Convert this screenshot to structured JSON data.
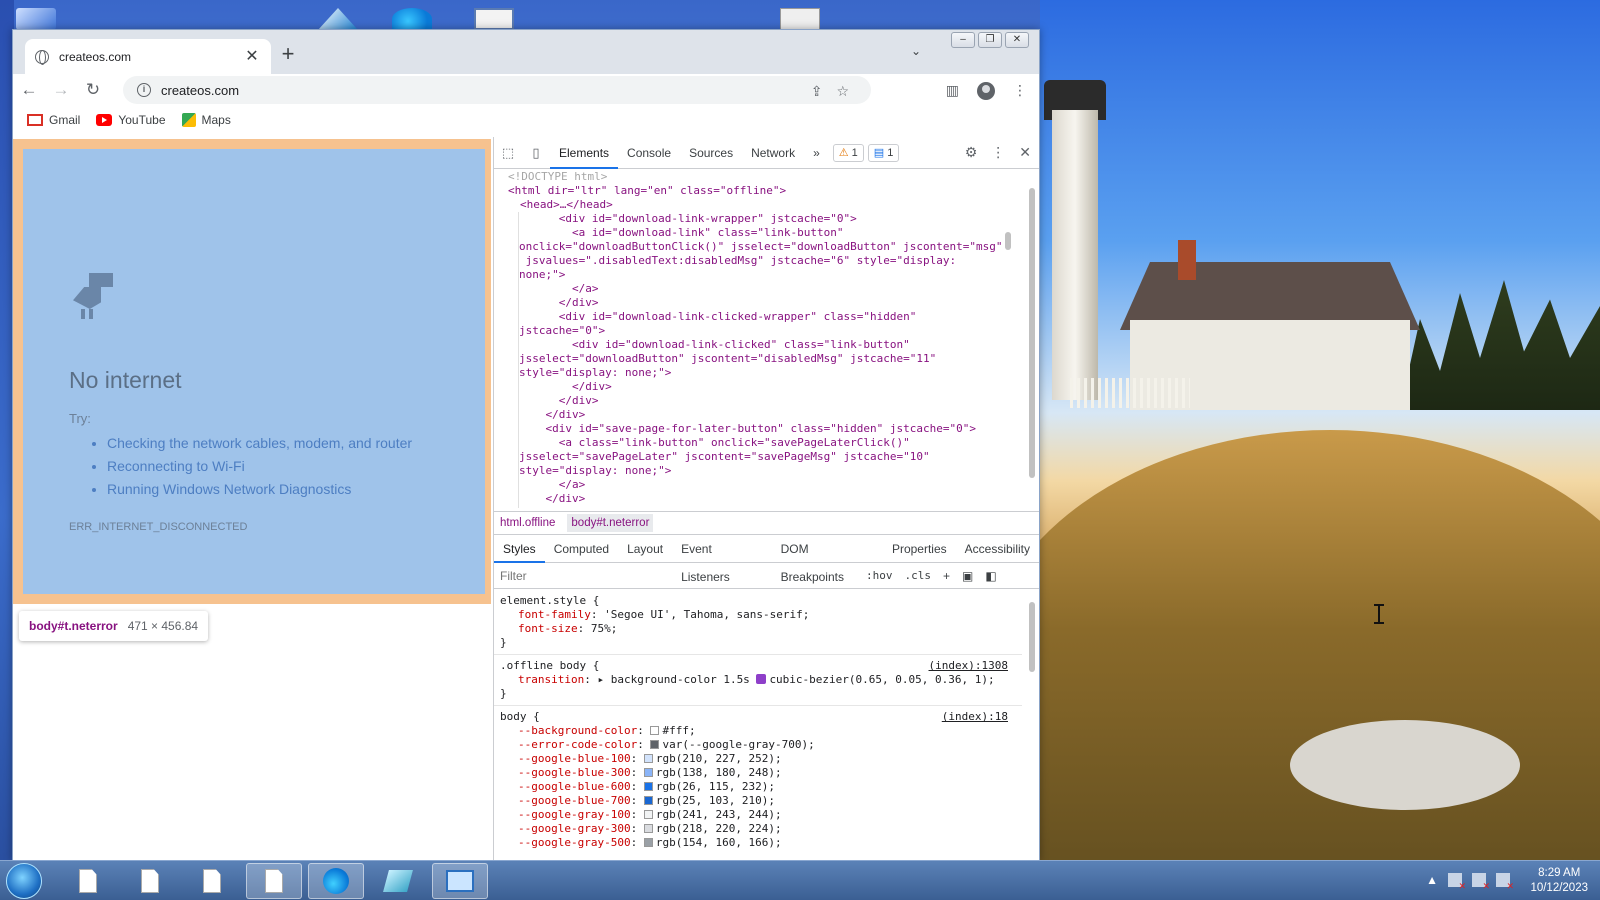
{
  "browser": {
    "tab_title": "createos.com",
    "new_tab": "+",
    "url": "createos.com",
    "bookmarks": [
      {
        "label": "Gmail"
      },
      {
        "label": "YouTube"
      },
      {
        "label": "Maps"
      }
    ]
  },
  "page": {
    "heading": "No internet",
    "try_label": "Try:",
    "suggestions": [
      "Checking the network cables, modem, and router",
      "Reconnecting to Wi-Fi",
      "Running Windows Network Diagnostics"
    ],
    "error_code": "ERR_INTERNET_DISCONNECTED",
    "inspect_tooltip": {
      "element": "body#t.neterror",
      "size": "471 × 456.84"
    }
  },
  "devtools": {
    "tabs": [
      "Elements",
      "Console",
      "Sources",
      "Network"
    ],
    "more_tabs": "»",
    "warnings": "1",
    "messages": "1",
    "dom_lines": [
      "<!DOCTYPE html>",
      "<html dir=\"ltr\" lang=\"en\" class=\"offline\">",
      "<head>…</head>",
      "      <div id=\"download-link-wrapper\" jstcache=\"0\">",
      "        <a id=\"download-link\" class=\"link-button\"",
      "onclick=\"downloadButtonClick()\" jsselect=\"downloadButton\" jscontent=\"msg\"",
      " jsvalues=\".disabledText:disabledMsg\" jstcache=\"6\" style=\"display:",
      "none;\">",
      "        </a>",
      "      </div>",
      "      <div id=\"download-link-clicked-wrapper\" class=\"hidden\"",
      "jstcache=\"0\">",
      "        <div id=\"download-link-clicked\" class=\"link-button\"",
      "jsselect=\"downloadButton\" jscontent=\"disabledMsg\" jstcache=\"11\"",
      "style=\"display: none;\">",
      "        </div>",
      "      </div>",
      "    </div>",
      "    <div id=\"save-page-for-later-button\" class=\"hidden\" jstcache=\"0\">",
      "      <a class=\"link-button\" onclick=\"savePageLaterClick()\"",
      "jsselect=\"savePageLater\" jscontent=\"savePageMsg\" jstcache=\"10\"",
      "style=\"display: none;\">",
      "      </a>",
      "    </div>"
    ],
    "breadcrumbs": [
      "html.offline",
      "body#t.neterror"
    ],
    "sub_tabs": [
      "Styles",
      "Computed",
      "Layout",
      "Event Listeners",
      "DOM Breakpoints",
      "Properties",
      "Accessibility"
    ],
    "filter_placeholder": "Filter",
    "hov": ":hov",
    "cls": ".cls",
    "styles": {
      "element_style": {
        "selector": "element.style {",
        "props": [
          {
            "name": "font-family",
            "value": "'Segoe UI', Tahoma, sans-serif;"
          },
          {
            "name": "font-size",
            "value": "75%;"
          }
        ]
      },
      "offline_body": {
        "selector": ".offline body {",
        "source": "(index):1308",
        "prop_name": "transition",
        "prop_value_a": "background-color 1.5s",
        "prop_value_b": "cubic-bezier(0.65, 0.05, 0.36, 1);"
      },
      "body_rule": {
        "selector": "body {",
        "source": "(index):18",
        "props": [
          {
            "name": "--background-color",
            "value": "#fff;",
            "swatch": "#ffffff"
          },
          {
            "name": "--error-code-color",
            "value": "var(--google-gray-700);",
            "swatch": "#5f6368"
          },
          {
            "name": "--google-blue-100",
            "value": "rgb(210, 227, 252);",
            "swatch": "#d2e3fc"
          },
          {
            "name": "--google-blue-300",
            "value": "rgb(138, 180, 248);",
            "swatch": "#8ab4f8"
          },
          {
            "name": "--google-blue-600",
            "value": "rgb(26, 115, 232);",
            "swatch": "#1a73e8"
          },
          {
            "name": "--google-blue-700",
            "value": "rgb(25, 103, 210);",
            "swatch": "#1967d2"
          },
          {
            "name": "--google-gray-100",
            "value": "rgb(241, 243, 244);",
            "swatch": "#f1f3f4"
          },
          {
            "name": "--google-gray-300",
            "value": "rgb(218, 220, 224);",
            "swatch": "#dadce0"
          },
          {
            "name": "--google-gray-500",
            "value": "rgb(154, 160, 166);",
            "swatch": "#9aa0a6"
          }
        ]
      }
    }
  },
  "taskbar": {
    "time": "8:29 AM",
    "date": "10/12/2023"
  }
}
